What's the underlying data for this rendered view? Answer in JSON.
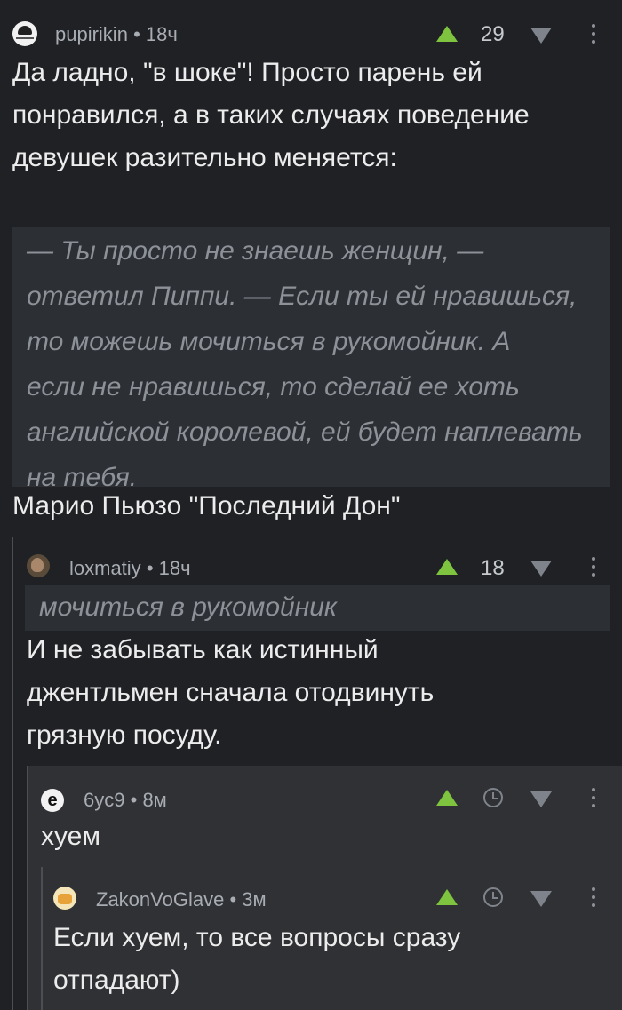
{
  "comments": [
    {
      "author": "pupirikin",
      "time": "18ч",
      "score": "29",
      "lines": [
        "Да ладно, \"в шоке\"! Просто парень ей",
        "понравился, а в таких случаях поведение",
        "девушек разительно меняется:"
      ],
      "quote_lines": [
        "— Ты просто не знаешь женщин, —",
        "ответил Пиппи. — Если ты ей нравишься,",
        "то можешь мочиться в рукомойник. А",
        "если не нравишься, то сделай ее хоть",
        "английской королевой, ей будет наплевать",
        "на тебя."
      ],
      "after_quote": "Марио Пьюзо \"Последний Дон\""
    },
    {
      "author": "loxmatiy",
      "time": "18ч",
      "score": "18",
      "quote": "мочиться в рукомойник",
      "lines": [
        "И не забывать как истинный",
        "джентльмен  сначала отодвинуть",
        "грязную посуду."
      ]
    },
    {
      "author": "6yc9",
      "time": "8м",
      "lines": [
        "хуем"
      ]
    },
    {
      "author": "ZakonVoGlave",
      "time": "3м",
      "lines": [
        "Если хуем, то все вопросы сразу",
        "отпадают)"
      ]
    }
  ],
  "separator": "•",
  "colors": {
    "background": "#1f2125",
    "highlight": "#2f3134",
    "quote_bg": "#2c2f34",
    "upvote": "#7ec43f",
    "meta_text": "#a8acb3"
  },
  "icons": {
    "upvote": "arrow-up-icon",
    "downvote": "arrow-down-icon",
    "more": "more-vertical-icon",
    "clock": "clock-icon"
  }
}
